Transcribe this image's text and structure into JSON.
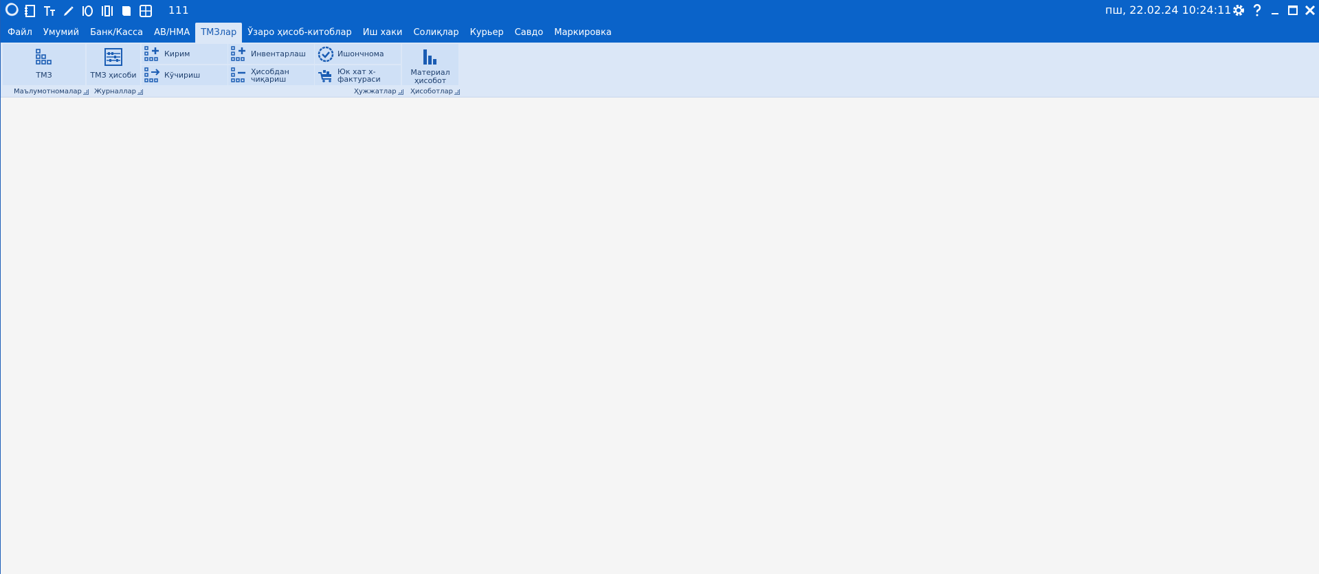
{
  "titlebar": {
    "quick_access_count": "111",
    "datetime": "пш, 22.02.24 10:24:11",
    "bg_color": "#0a63c9"
  },
  "menu": {
    "tabs": [
      {
        "label": "Файл"
      },
      {
        "label": "Умумий"
      },
      {
        "label": "Банк/Касса"
      },
      {
        "label": "АВ/НМА"
      },
      {
        "label": "ТМЗлар",
        "active": true
      },
      {
        "label": "Ўзаро ҳисоб-китоблар"
      },
      {
        "label": "Иш хаки"
      },
      {
        "label": "Солиқлар"
      },
      {
        "label": "Курьер"
      },
      {
        "label": "Савдо"
      },
      {
        "label": "Маркировка"
      }
    ]
  },
  "ribbon": {
    "buttons": {
      "tmz": "ТМЗ",
      "tmz_hisobi": "ТМЗ ҳисоби",
      "kirim": "Кирим",
      "kuchirish": "Кўчириш",
      "inventarlash": "Инвентарлаш",
      "hisobdan_line1": "Ҳисобдан",
      "hisobdan_line2": "чиқариш",
      "ishonchnoma": "Ишончнома",
      "yuk_line1": "Юк хат х-",
      "yuk_line2": "фактураси",
      "material_line1": "Материал",
      "material_line2": "ҳисобот"
    },
    "groups": {
      "malumotnomalar": "Маълумотномалар",
      "jurnallar": "Журналлар",
      "hujjatlar": "Ҳужжатлар",
      "hisobotlar": "Ҳисоботлар"
    }
  }
}
